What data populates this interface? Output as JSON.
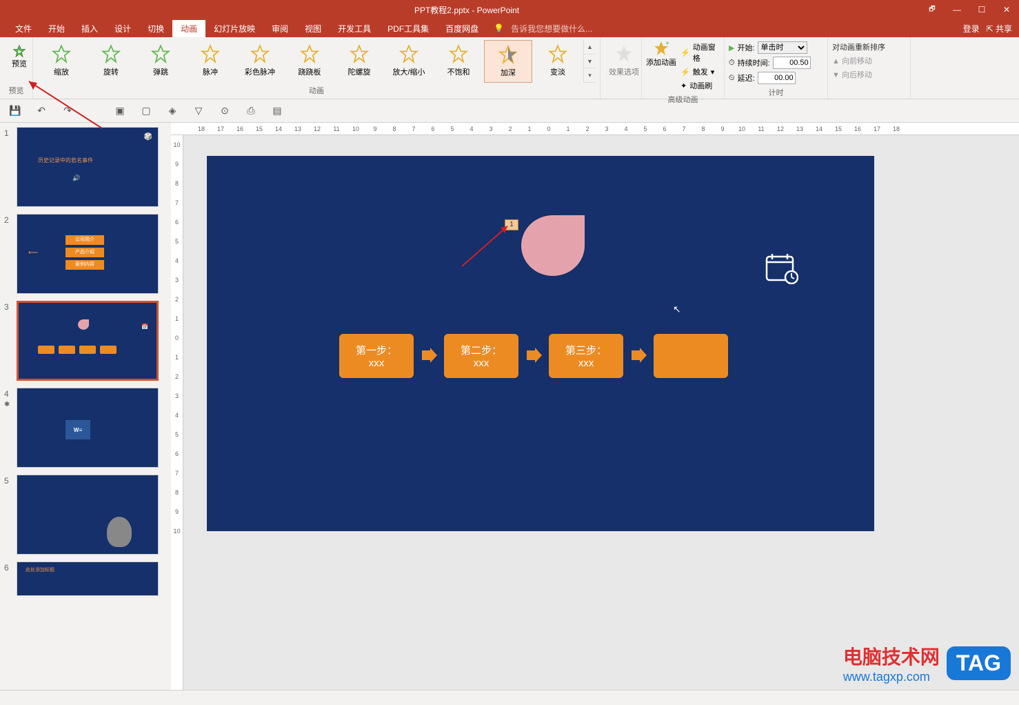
{
  "titlebar": {
    "title": "PPT教程2.pptx - PowerPoint"
  },
  "win": {
    "restore": "🗗",
    "min": "—",
    "max": "☐",
    "close": "✕"
  },
  "menu": {
    "tabs": [
      "文件",
      "开始",
      "插入",
      "设计",
      "切换",
      "动画",
      "幻灯片放映",
      "审阅",
      "视图",
      "开发工具",
      "PDF工具集",
      "百度网盘"
    ],
    "active_index": 5,
    "tellme_icon": "💡",
    "tellme": "告诉我您想要做什么...",
    "login": "登录",
    "share": "共享"
  },
  "ribbon": {
    "preview": "预览",
    "preview_group": "预览",
    "animations": [
      "缩放",
      "旋转",
      "弹跳",
      "脉冲",
      "彩色脉冲",
      "跷跷板",
      "陀螺旋",
      "放大/缩小",
      "不饱和",
      "加深",
      "变淡"
    ],
    "selected_anim_index": 9,
    "anim_group": "动画",
    "effect_options": "效果选项",
    "add_anim": "添加动画",
    "anim_pane": "动画窗格",
    "trigger": "触发",
    "anim_painter": "动画刷",
    "adv_group": "高级动画",
    "start_label": "开始:",
    "start_value": "单击时",
    "duration_label": "持续时间:",
    "duration_value": "00.50",
    "delay_label": "延迟:",
    "delay_value": "00.00",
    "timing_group": "计时",
    "reorder_title": "对动画重新排序",
    "move_earlier": "向前移动",
    "move_later": "向后移动"
  },
  "qat": {
    "save": "💾",
    "undo": "↶",
    "redo": "↷"
  },
  "ruler_h": [
    "18",
    "17",
    "16",
    "15",
    "14",
    "13",
    "12",
    "11",
    "10",
    "9",
    "8",
    "7",
    "6",
    "5",
    "4",
    "3",
    "2",
    "1",
    "0",
    "1",
    "2",
    "3",
    "4",
    "5",
    "6",
    "7",
    "8",
    "9",
    "10",
    "11",
    "12",
    "13",
    "14",
    "15",
    "16",
    "17",
    "18"
  ],
  "ruler_v": [
    "10",
    "9",
    "8",
    "7",
    "6",
    "5",
    "4",
    "3",
    "2",
    "1",
    "0",
    "1",
    "2",
    "3",
    "4",
    "5",
    "6",
    "7",
    "8",
    "9",
    "10"
  ],
  "slide": {
    "anim_tag": "1",
    "steps": [
      {
        "title": "第一步：",
        "sub": "xxx"
      },
      {
        "title": "第二步：",
        "sub": "xxx"
      },
      {
        "title": "第三步：",
        "sub": "xxx"
      },
      {
        "title": "",
        "sub": ""
      }
    ]
  },
  "thumbs": {
    "t1_title": "历史记录中的若名事件",
    "t1_sub": "",
    "t2_items": [
      "公司简介",
      "产品介绍",
      "案例内容"
    ],
    "t6_caption": "此处添加标题"
  },
  "watermark": {
    "cn": "电脑技术网",
    "url": "www.tagxp.com",
    "tag": "TAG"
  }
}
